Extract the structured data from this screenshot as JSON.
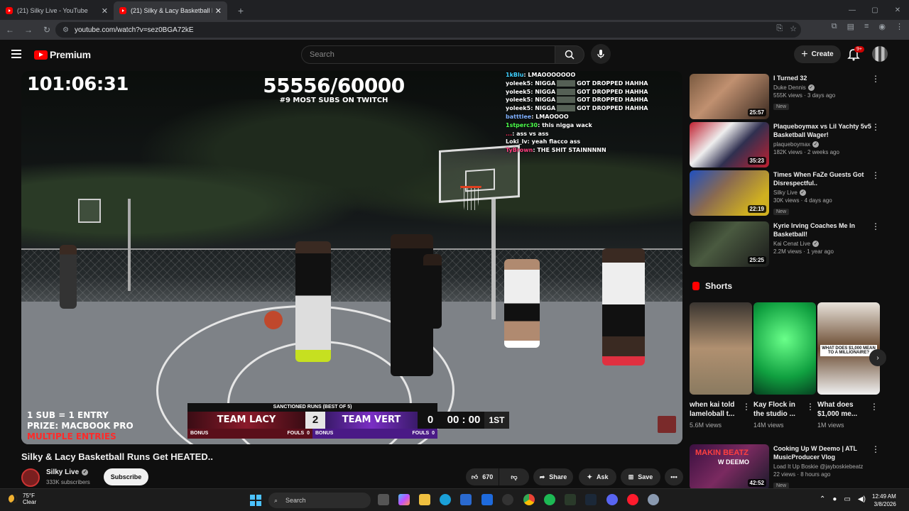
{
  "browser": {
    "tabs": [
      {
        "title": "(21) Silky Live - YouTube",
        "close": "✕"
      },
      {
        "title": "(21) Silky & Lacy Basketball Runs",
        "close": "✕"
      }
    ],
    "new_tab": "+",
    "url": "youtube.com/watch?v=sez0BGA72kE"
  },
  "youtube": {
    "logo_text": "Premium",
    "search_placeholder": "Search",
    "create_label": "Create",
    "notification_count": "9+"
  },
  "video": {
    "overlay": {
      "timer": "101:06:31",
      "subs": "55556/60000",
      "rank": "#9 MOST SUBS ON TWITCH",
      "giveaway_line1": "1 SUB = 1 ENTRY",
      "giveaway_line2": "PRIZE: MACBOOK PRO",
      "giveaway_line3": "MULTIPLE ENTRIES"
    },
    "chat": [
      {
        "user": "1kBlu",
        "color": "#3fd0ff",
        "msg": "LMAOOOOOOO"
      },
      {
        "user": "yoleek5",
        "color": "#ffffff",
        "msg": "NIGGA",
        "tail": "GOT DROPPED HAHHA"
      },
      {
        "user": "yoleek5",
        "color": "#ffffff",
        "msg": "NIGGA",
        "tail": "GOT DROPPED HAHHA"
      },
      {
        "user": "yoleek5",
        "color": "#ffffff",
        "msg": "NIGGA",
        "tail": "GOT DROPPED HAHHA"
      },
      {
        "user": "yoleek5",
        "color": "#ffffff",
        "msg": "NIGGA",
        "tail": "GOT DROPPED HAHHA"
      },
      {
        "user": "batttlee",
        "color": "#7fb0ff",
        "msg": "LMAOOOO"
      },
      {
        "user": "1stperc30",
        "color": "#4cff4c",
        "msg": "this nigga wack"
      },
      {
        "user": "...",
        "color": "#ff2a5a",
        "msg": "ass vs ass"
      },
      {
        "user": "Loki_lv",
        "color": "#ffffff",
        "msg": "yeah flacco ass"
      },
      {
        "user": "TyBrown",
        "color": "#ff4080",
        "msg": "THE SHIT STAINNNNN"
      }
    ],
    "scoreboard": {
      "title": "SANCTIONED RUNS (BEST OF 5)",
      "team1": "TEAM LACY",
      "score1": "2",
      "team2": "TEAM VERT",
      "score2": "0",
      "clock": "00 : 00",
      "period": "1ST",
      "bonus1": "BONUS",
      "fouls1_label": "FOULS",
      "fouls1": "0",
      "bonus2": "BONUS",
      "fouls2_label": "FOULS",
      "fouls2": "0"
    },
    "title": "Silky & Lacy Basketball Runs Get HEATED..",
    "channel": "Silky Live",
    "subscribers": "333K subscribers",
    "subscribe_label": "Subscribe",
    "likes": "670",
    "share_label": "Share",
    "ask_label": "Ask",
    "save_label": "Save"
  },
  "sidebar": {
    "recommendations": [
      {
        "title": "I Turned 32",
        "channel": "Duke Dennis",
        "meta": "555K views · 3 days ago",
        "badge": "New",
        "duration": "25:57"
      },
      {
        "title": "Plaqueboymax vs Lil Yachty 5v5 Basketball Wager!",
        "channel": "plaqueboymax",
        "meta": "182K views · 2 weeks ago",
        "badge": "",
        "duration": "35:23"
      },
      {
        "title": "Times When FaZe Guests Got Disrespectful..",
        "channel": "Silky Live",
        "meta": "30K views · 4 days ago",
        "badge": "New",
        "duration": "22:19"
      },
      {
        "title": "Kyrie Irving Coaches Me In Basketball!",
        "channel": "Kai Cenat Live",
        "meta": "2.2M views · 1 year ago",
        "badge": "",
        "duration": "25:25"
      }
    ],
    "shorts_heading": "Shorts",
    "shorts": [
      {
        "title": "when kai told lameloball t...",
        "views": "5.6M views"
      },
      {
        "title": "Kay Flock in the studio ...",
        "views": "14M views"
      },
      {
        "title": "What does $1,000 me...",
        "views": "1M views",
        "caption": "WHAT DOES $1,000 MEAN TO A MILLIONAIRE?"
      }
    ],
    "bottom_rec": {
      "title": "Cooking Up W Deemo | ATL MusicProducer Vlog",
      "channel": "Load It Up Boskie @jayboskiebeatz",
      "meta": "22 views · 8 hours ago",
      "badge": "New",
      "duration": "42:52",
      "thumb_text1": "MAKIN BEATZ",
      "thumb_text2": "W DEEMO"
    }
  },
  "taskbar": {
    "temp": "75°F",
    "condition": "Clear",
    "search_label": "Search",
    "time": "12:49 AM",
    "date": "3/8/2026"
  }
}
